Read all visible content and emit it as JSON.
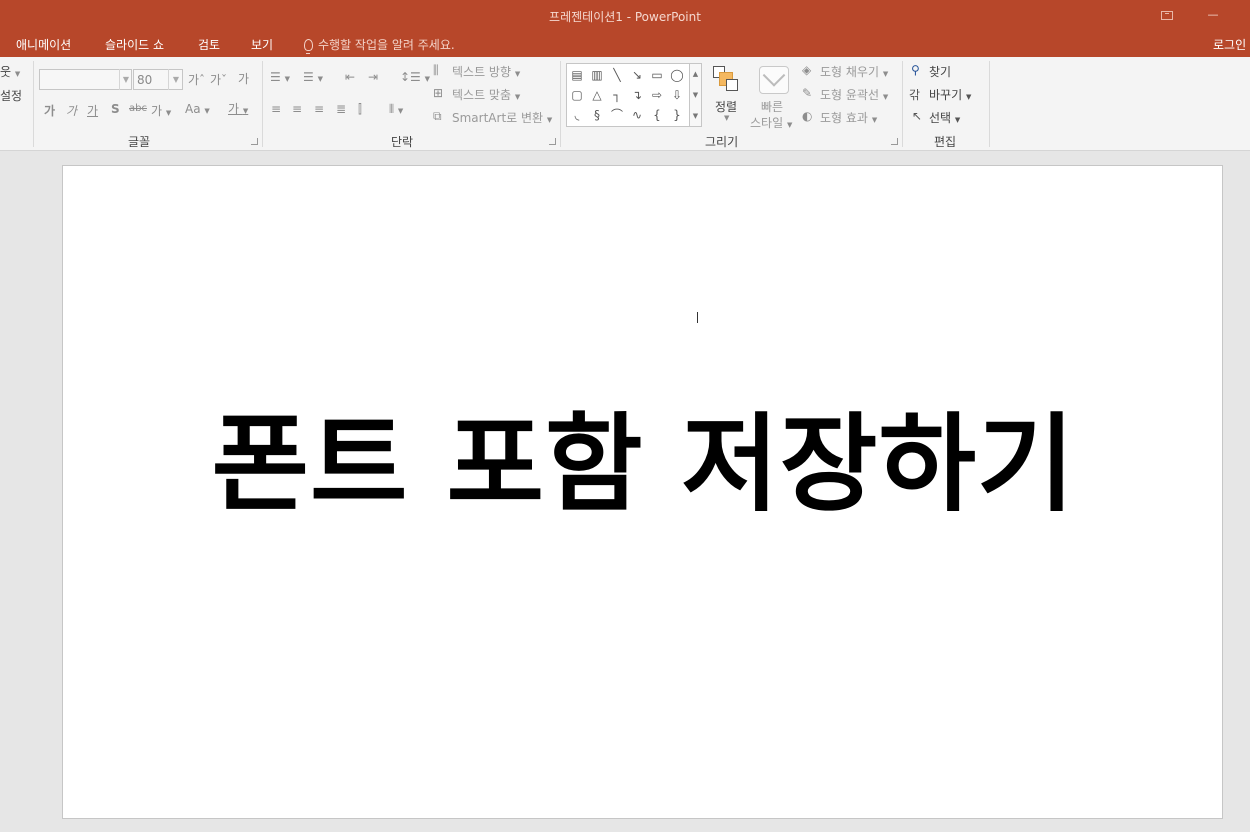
{
  "window": {
    "title": "프레젠테이션1 - PowerPoint"
  },
  "menu": {
    "tabs": [
      "애니메이션",
      "슬라이드 쇼",
      "검토",
      "보기"
    ],
    "tell_me": "수행할 작업을 알려 주세요.",
    "login": "로그인"
  },
  "ribbon": {
    "cut_left": {
      "layout_partial": "웃",
      "reset_partial": "설정"
    },
    "font": {
      "font_name": "",
      "font_size": "80",
      "label": "글꼴"
    },
    "paragraph": {
      "text_direction": "텍스트 방향",
      "align_text": "텍스트 맞춤",
      "smartart": "SmartArt로 변환",
      "label": "단락"
    },
    "drawing": {
      "arrange": "정렬",
      "quick_styles_line1": "빠른",
      "quick_styles_line2": "스타일",
      "shape_fill": "도형 채우기",
      "shape_outline": "도형 윤곽선",
      "shape_effects": "도형 효과",
      "label": "그리기"
    },
    "editing": {
      "find": "찾기",
      "replace": "바꾸기",
      "select": "선택",
      "label": "편집"
    }
  },
  "slide": {
    "title_text": "폰트 포함 저장하기"
  },
  "colors": {
    "accent": "#b7472a",
    "ribbon_bg": "#f4f4f4",
    "workspace_bg": "#e6e6e6"
  }
}
